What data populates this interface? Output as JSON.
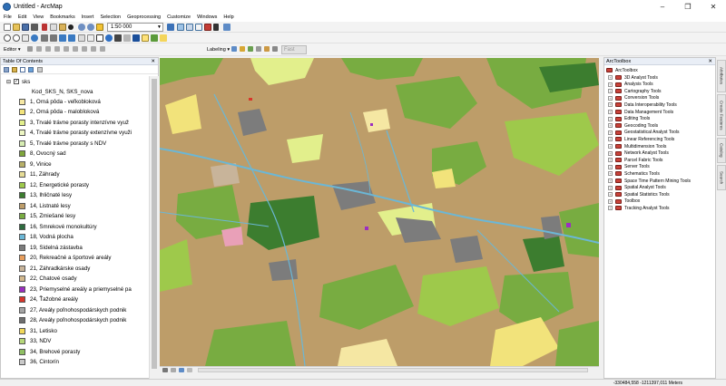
{
  "window": {
    "title": "Untitled - ArcMap",
    "controls": [
      "–",
      "❐",
      "✕"
    ]
  },
  "menu": [
    "File",
    "Edit",
    "View",
    "Bookmarks",
    "Insert",
    "Selection",
    "Geoprocessing",
    "Customize",
    "Windows",
    "Help"
  ],
  "toolbar": {
    "scale_value": "1:50 000",
    "editor_label": "Editor ▾",
    "labeling_label": "Labeling ▾",
    "fast_label": "Fast"
  },
  "toc": {
    "title": "Table Of Contents",
    "layer_name": "sks",
    "field_label": "Kod_SKS_N, SKS_nova",
    "classes": [
      {
        "label": "1, Orná pôda - veľkobloková",
        "color": "#f5e7a3"
      },
      {
        "label": "2, Orná pôda - malobloková",
        "color": "#f2e37b"
      },
      {
        "label": "3, Trvalé trávne porasty intenzívne využ",
        "color": "#e2ef8c"
      },
      {
        "label": "4, Trvalé trávne porasty extenzívne využi",
        "color": "#edf6c3"
      },
      {
        "label": "5, Trvalé trávne porasty s NDV",
        "color": "#d6ecb2"
      },
      {
        "label": "8, Ovocný sad",
        "color": "#7fa63b"
      },
      {
        "label": "9, Vinice",
        "color": "#b8b068"
      },
      {
        "label": "11, Záhrady",
        "color": "#e6dc96"
      },
      {
        "label": "12, Energetické porasty",
        "color": "#9ec94b"
      },
      {
        "label": "13, Ihličnaté lesy",
        "color": "#3c7d2f"
      },
      {
        "label": "14, Listnaté lesy",
        "color": "#bd9d69"
      },
      {
        "label": "15, Zmiešané lesy",
        "color": "#78ac41"
      },
      {
        "label": "16, Smrekové monokultúry",
        "color": "#2e6b3f"
      },
      {
        "label": "18, Vodná plocha",
        "color": "#6bb7d6"
      },
      {
        "label": "19, Sídelná zástavba",
        "color": "#7c7c7c"
      },
      {
        "label": "20, Rekreačné a športové areály",
        "color": "#e89e5c"
      },
      {
        "label": "21, Záhradkárske osady",
        "color": "#c8b49a"
      },
      {
        "label": "22, Chatové osady",
        "color": "#d3b98e"
      },
      {
        "label": "23, Priemyselné areály a priemyselné pa",
        "color": "#9b2fc0"
      },
      {
        "label": "24, Ťažobné areály",
        "color": "#d8362b"
      },
      {
        "label": "27, Areály poľnohospodárskych podnik",
        "color": "#a5a5a5"
      },
      {
        "label": "28, Areály poľnohospodárskych podnik",
        "color": "#6e6e6e"
      },
      {
        "label": "31, Letisko",
        "color": "#f1d85a"
      },
      {
        "label": "33, NDV",
        "color": "#b6d77a"
      },
      {
        "label": "34, Brehové porasty",
        "color": "#8fbf63"
      },
      {
        "label": "36, Cintorín",
        "color": "#c9c9c9"
      }
    ]
  },
  "arctoolbox": {
    "title": "ArcToolbox",
    "root": "ArcToolbox",
    "items": [
      "3D Analyst Tools",
      "Analysis Tools",
      "Cartography Tools",
      "Conversion Tools",
      "Data Interoperability Tools",
      "Data Management Tools",
      "Editing Tools",
      "Geocoding Tools",
      "Geostatistical Analyst Tools",
      "Linear Referencing Tools",
      "Multidimension Tools",
      "Network Analyst Tools",
      "Parcel Fabric Tools",
      "Server Tools",
      "Schematics Tools",
      "Space Time Pattern Mining Tools",
      "Spatial Analyst Tools",
      "Spatial Statistics Tools",
      "Toolbox",
      "Tracking Analyst Tools"
    ]
  },
  "side_tabs": [
    "Attributes",
    "Create Features",
    "Catalog",
    "Search"
  ],
  "status": {
    "coords": "-330484,558  -1211397,011 Meters"
  }
}
